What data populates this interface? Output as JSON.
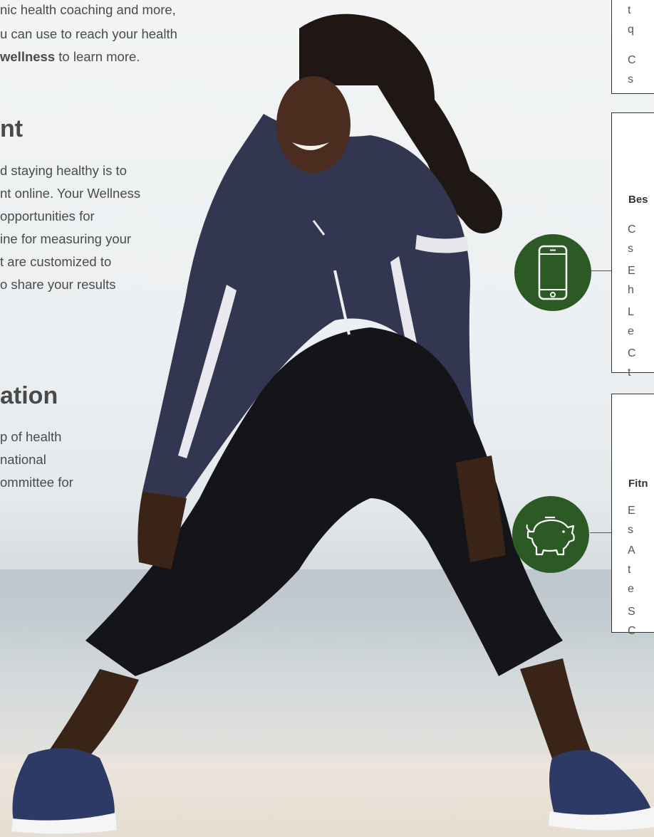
{
  "left_column": {
    "intro_lines": [
      "nic health coaching and more,",
      "u can use to reach your health"
    ],
    "intro_bold": "wellness",
    "intro_tail": " to learn more.",
    "section1_heading": "nt",
    "section1_lines": [
      "d staying healthy is to",
      "nt online. Your Wellness",
      "opportunities for",
      "ine for measuring your",
      "t are customized to",
      "o share your results"
    ],
    "section2_heading": "ation",
    "section2_lines": [
      "p of health",
      "national",
      "ommittee for"
    ]
  },
  "right_column": {
    "box1_lines": [
      "t",
      "q",
      "C",
      "s"
    ],
    "box2_title": "Bes",
    "box2_lines": [
      "C",
      "s",
      "E",
      "h",
      "L",
      "e",
      "C",
      "t"
    ],
    "box3_title": "Fitn",
    "box3_lines": [
      "E",
      "s",
      "A",
      "t",
      "e",
      "S",
      "C"
    ]
  },
  "icons": {
    "phone": "smartphone-icon",
    "piggy": "piggy-bank-icon",
    "circle_color": "#2b5a24"
  }
}
